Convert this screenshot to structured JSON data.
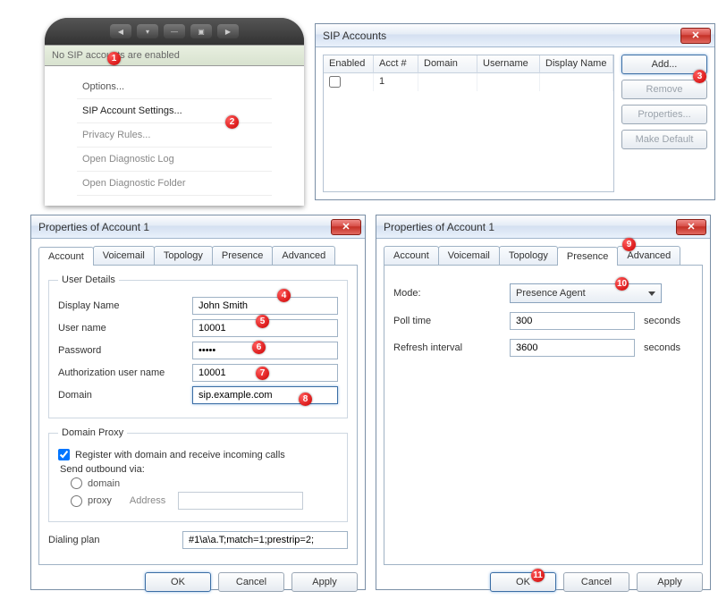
{
  "phone": {
    "status_text": "No SIP accounts are enabled",
    "menu": {
      "options": "Options...",
      "sip_account_settings": "SIP Account Settings...",
      "privacy_rules": "Privacy Rules...",
      "open_diag_log": "Open Diagnostic Log",
      "open_diag_folder": "Open Diagnostic Folder"
    }
  },
  "sip_window": {
    "title": "SIP Accounts",
    "columns": {
      "enabled": "Enabled",
      "acct": "Acct #",
      "domain": "Domain",
      "username": "Username",
      "display": "Display Name"
    },
    "row": {
      "acct": "1"
    },
    "buttons": {
      "add": "Add...",
      "remove": "Remove",
      "properties": "Properties...",
      "make_default": "Make Default"
    }
  },
  "prop1": {
    "title": "Properties of Account 1",
    "tabs": {
      "account": "Account",
      "voicemail": "Voicemail",
      "topology": "Topology",
      "presence": "Presence",
      "advanced": "Advanced"
    },
    "user_details": {
      "legend": "User Details",
      "display_name_label": "Display Name",
      "display_name": "John Smith",
      "user_name_label": "User name",
      "user_name": "10001",
      "password_label": "Password",
      "password": "•••••",
      "auth_user_label": "Authorization user name",
      "auth_user": "10001",
      "domain_label": "Domain",
      "domain": "sip.example.com"
    },
    "domain_proxy": {
      "legend": "Domain Proxy",
      "register_label": "Register with domain and receive incoming calls",
      "send_via_label": "Send outbound via:",
      "opt_domain": "domain",
      "opt_proxy": "proxy",
      "address_label": "Address"
    },
    "dialing_plan_label": "Dialing plan",
    "dialing_plan": "#1\\a\\a.T;match=1;prestrip=2;",
    "buttons": {
      "ok": "OK",
      "cancel": "Cancel",
      "apply": "Apply"
    }
  },
  "prop2": {
    "title": "Properties of Account 1",
    "tabs": {
      "account": "Account",
      "voicemail": "Voicemail",
      "topology": "Topology",
      "presence": "Presence",
      "advanced": "Advanced"
    },
    "mode_label": "Mode:",
    "mode_value": "Presence Agent",
    "poll_label": "Poll time",
    "poll_value": "300",
    "refresh_label": "Refresh interval",
    "refresh_value": "3600",
    "seconds": "seconds",
    "buttons": {
      "ok": "OK",
      "cancel": "Cancel",
      "apply": "Apply"
    }
  },
  "badges": {
    "b1": "1",
    "b2": "2",
    "b3": "3",
    "b4": "4",
    "b5": "5",
    "b6": "6",
    "b7": "7",
    "b8": "8",
    "b9": "9",
    "b10": "10",
    "b11": "11"
  }
}
